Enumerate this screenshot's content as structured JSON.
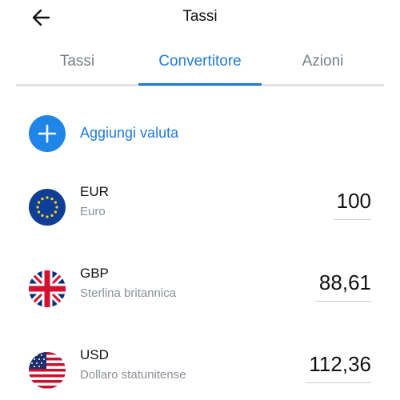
{
  "header": {
    "title": "Tassi"
  },
  "tabs": [
    {
      "label": "Tassi"
    },
    {
      "label": "Convertitore"
    },
    {
      "label": "Azioni"
    }
  ],
  "add_currency": {
    "label": "Aggiungi valuta"
  },
  "currencies": [
    {
      "code": "EUR",
      "name": "Euro",
      "amount": "100"
    },
    {
      "code": "GBP",
      "name": "Sterlina britannica",
      "amount": "88,61"
    },
    {
      "code": "USD",
      "name": "Dollaro statunitense",
      "amount": "112,36"
    }
  ],
  "colors": {
    "accent": "#1f7ad6",
    "add_button": "#1f86e8"
  }
}
